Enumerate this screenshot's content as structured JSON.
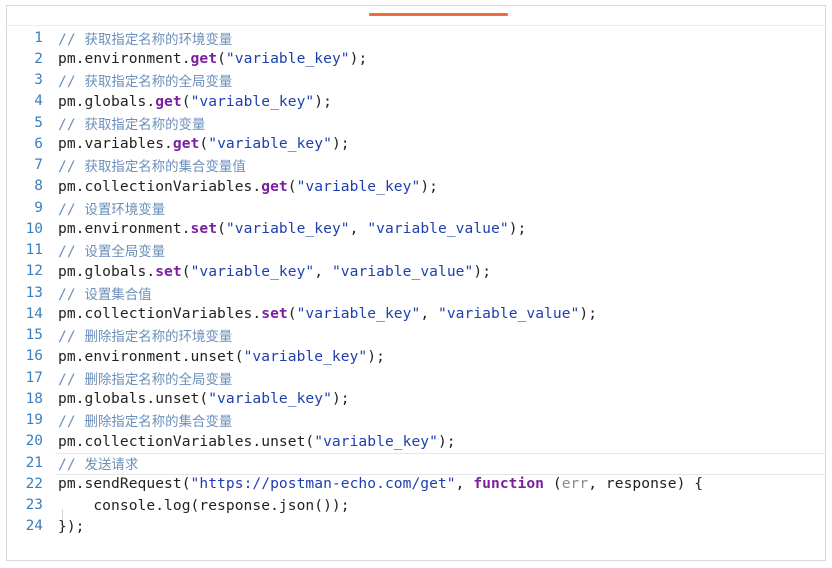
{
  "editor": {
    "lines": [
      {
        "n": "1",
        "parts": [
          {
            "c": "cm",
            "t": "// "
          },
          {
            "c": "cm-cjk",
            "t": "获取指定名称的环境变量"
          }
        ]
      },
      {
        "n": "2",
        "parts": [
          {
            "c": "",
            "t": "pm.environment."
          },
          {
            "c": "kw",
            "t": "get"
          },
          {
            "c": "",
            "t": "("
          },
          {
            "c": "str",
            "t": "\"variable_key\""
          },
          {
            "c": "",
            "t": ");"
          }
        ]
      },
      {
        "n": "3",
        "parts": [
          {
            "c": "cm",
            "t": "// "
          },
          {
            "c": "cm-cjk",
            "t": "获取指定名称的全局变量"
          }
        ]
      },
      {
        "n": "4",
        "parts": [
          {
            "c": "",
            "t": "pm.globals."
          },
          {
            "c": "kw",
            "t": "get"
          },
          {
            "c": "",
            "t": "("
          },
          {
            "c": "str",
            "t": "\"variable_key\""
          },
          {
            "c": "",
            "t": ");"
          }
        ]
      },
      {
        "n": "5",
        "parts": [
          {
            "c": "cm",
            "t": "// "
          },
          {
            "c": "cm-cjk",
            "t": "获取指定名称的变量"
          }
        ]
      },
      {
        "n": "6",
        "parts": [
          {
            "c": "",
            "t": "pm.variables."
          },
          {
            "c": "kw",
            "t": "get"
          },
          {
            "c": "",
            "t": "("
          },
          {
            "c": "str",
            "t": "\"variable_key\""
          },
          {
            "c": "",
            "t": ");"
          }
        ]
      },
      {
        "n": "7",
        "parts": [
          {
            "c": "cm",
            "t": "// "
          },
          {
            "c": "cm-cjk",
            "t": "获取指定名称的集合变量值"
          }
        ]
      },
      {
        "n": "8",
        "parts": [
          {
            "c": "",
            "t": "pm.collectionVariables."
          },
          {
            "c": "kw",
            "t": "get"
          },
          {
            "c": "",
            "t": "("
          },
          {
            "c": "str",
            "t": "\"variable_key\""
          },
          {
            "c": "",
            "t": ");"
          }
        ]
      },
      {
        "n": "9",
        "parts": [
          {
            "c": "cm",
            "t": "// "
          },
          {
            "c": "cm-cjk",
            "t": "设置环境变量"
          }
        ]
      },
      {
        "n": "10",
        "parts": [
          {
            "c": "",
            "t": "pm.environment."
          },
          {
            "c": "kw",
            "t": "set"
          },
          {
            "c": "",
            "t": "("
          },
          {
            "c": "str",
            "t": "\"variable_key\""
          },
          {
            "c": "",
            "t": ", "
          },
          {
            "c": "str",
            "t": "\"variable_value\""
          },
          {
            "c": "",
            "t": ");"
          }
        ]
      },
      {
        "n": "11",
        "parts": [
          {
            "c": "cm",
            "t": "// "
          },
          {
            "c": "cm-cjk",
            "t": "设置全局变量"
          }
        ]
      },
      {
        "n": "12",
        "parts": [
          {
            "c": "",
            "t": "pm.globals."
          },
          {
            "c": "kw",
            "t": "set"
          },
          {
            "c": "",
            "t": "("
          },
          {
            "c": "str",
            "t": "\"variable_key\""
          },
          {
            "c": "",
            "t": ", "
          },
          {
            "c": "str",
            "t": "\"variable_value\""
          },
          {
            "c": "",
            "t": ");"
          }
        ]
      },
      {
        "n": "13",
        "parts": [
          {
            "c": "cm",
            "t": "// "
          },
          {
            "c": "cm-cjk",
            "t": "设置集合值"
          }
        ]
      },
      {
        "n": "14",
        "parts": [
          {
            "c": "",
            "t": "pm.collectionVariables."
          },
          {
            "c": "kw",
            "t": "set"
          },
          {
            "c": "",
            "t": "("
          },
          {
            "c": "str",
            "t": "\"variable_key\""
          },
          {
            "c": "",
            "t": ", "
          },
          {
            "c": "str",
            "t": "\"variable_value\""
          },
          {
            "c": "",
            "t": ");"
          }
        ]
      },
      {
        "n": "15",
        "parts": [
          {
            "c": "cm",
            "t": "// "
          },
          {
            "c": "cm-cjk",
            "t": "删除指定名称的环境变量"
          }
        ]
      },
      {
        "n": "16",
        "parts": [
          {
            "c": "",
            "t": "pm.environment.unset("
          },
          {
            "c": "str",
            "t": "\"variable_key\""
          },
          {
            "c": "",
            "t": ");"
          }
        ]
      },
      {
        "n": "17",
        "parts": [
          {
            "c": "cm",
            "t": "// "
          },
          {
            "c": "cm-cjk",
            "t": "删除指定名称的全局变量"
          }
        ]
      },
      {
        "n": "18",
        "parts": [
          {
            "c": "",
            "t": "pm.globals.unset("
          },
          {
            "c": "str",
            "t": "\"variable_key\""
          },
          {
            "c": "",
            "t": ");"
          }
        ]
      },
      {
        "n": "19",
        "parts": [
          {
            "c": "cm",
            "t": "// "
          },
          {
            "c": "cm-cjk",
            "t": "删除指定名称的集合变量"
          }
        ]
      },
      {
        "n": "20",
        "parts": [
          {
            "c": "",
            "t": "pm.collectionVariables.unset("
          },
          {
            "c": "str",
            "t": "\"variable_key\""
          },
          {
            "c": "",
            "t": ");"
          }
        ]
      },
      {
        "n": "21",
        "parts": [
          {
            "c": "cm",
            "t": "// "
          },
          {
            "c": "cm-cjk",
            "t": "发送请求"
          }
        ]
      },
      {
        "n": "22",
        "parts": [
          {
            "c": "",
            "t": "pm.sendRequest("
          },
          {
            "c": "str",
            "t": "\"https://postman-echo.com/get\""
          },
          {
            "c": "",
            "t": ", "
          },
          {
            "c": "kwf",
            "t": "function"
          },
          {
            "c": "",
            "t": " ("
          },
          {
            "c": "param-muted",
            "t": "err"
          },
          {
            "c": "",
            "t": ", response) {"
          }
        ]
      },
      {
        "n": "23",
        "parts": [
          {
            "c": "",
            "t": "    console.log(response.json());"
          }
        ]
      },
      {
        "n": "24",
        "parts": [
          {
            "c": "",
            "t": "});"
          }
        ]
      }
    ]
  },
  "colors": {
    "tab_indicator": "#f26b3a",
    "line_number": "#3a7fc0",
    "comment": "#6b8fba",
    "keyword": "#7b1fa2",
    "string": "#1e40af",
    "text": "#222222"
  }
}
